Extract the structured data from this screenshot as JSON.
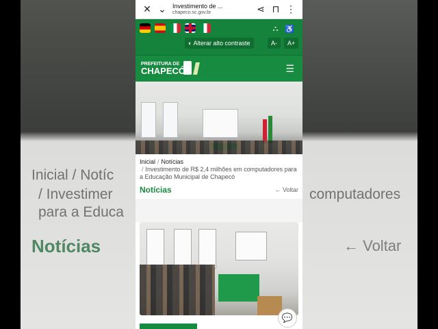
{
  "browser": {
    "title": "Investimento de ...",
    "url": "chapeco.sc.gov.br",
    "icons": [
      "close-icon",
      "chevron-down-icon",
      "share-icon",
      "bookmark-icon",
      "more-icon"
    ]
  },
  "accessibility": {
    "contrast_label": "Alterar alto contraste",
    "font_minus": "A-",
    "font_plus": "A+",
    "flags": [
      {
        "name": "flag-germany",
        "colors": [
          "#000000",
          "#dd0000",
          "#ffce00"
        ]
      },
      {
        "name": "flag-spain",
        "colors": [
          "#c60b1e",
          "#ffc400",
          "#c60b1e"
        ]
      },
      {
        "name": "flag-italy",
        "colors": [
          "#009246",
          "#ffffff",
          "#ce2b37"
        ]
      },
      {
        "name": "flag-uk",
        "colors": [
          "#012169",
          "#ffffff",
          "#c8102e"
        ]
      },
      {
        "name": "flag-italy-2",
        "colors": [
          "#009246",
          "#ffffff",
          "#ce2b37"
        ]
      }
    ]
  },
  "header": {
    "logo_small": "PREFEITURA DE",
    "logo_big": "CHAPECÓ"
  },
  "breadcrumb": {
    "home": "Inicial",
    "section": "Notícias",
    "current": "Investimento de R$ 2,4 milhões em computadores para a Educação Municipal de Chapecó"
  },
  "section": {
    "title": "Notícias",
    "back": "← Voltar"
  },
  "background": {
    "line1": "Inicial  /  Notíc",
    "line2": "/  Investimer",
    "line3": "para a Educa",
    "right1": "computadores",
    "green": "Notícias",
    "voltar": "← Voltar"
  },
  "colors": {
    "brand": "#16833d"
  }
}
